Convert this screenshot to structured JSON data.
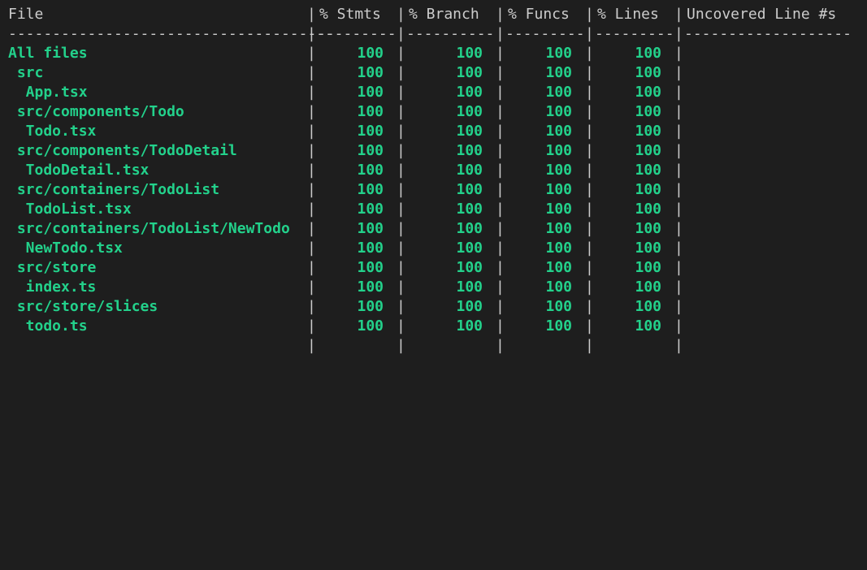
{
  "header": {
    "file": "File",
    "stmts": "% Stmts",
    "branch": "% Branch",
    "funcs": "% Funcs",
    "lines": "% Lines",
    "uncovered": "Uncovered Line #s"
  },
  "separator": {
    "file": "-------------------------------------",
    "stmts": "---------",
    "branch": "----------",
    "funcs": "---------",
    "lines": "---------",
    "uncovered": "-------------------"
  },
  "pipe": "|",
  "rows": [
    {
      "file": "All files",
      "stmts": "100",
      "branch": "100",
      "funcs": "100",
      "lines": "100",
      "uncovered": ""
    },
    {
      "file": " src",
      "stmts": "100",
      "branch": "100",
      "funcs": "100",
      "lines": "100",
      "uncovered": ""
    },
    {
      "file": "  App.tsx",
      "stmts": "100",
      "branch": "100",
      "funcs": "100",
      "lines": "100",
      "uncovered": ""
    },
    {
      "file": " src/components/Todo",
      "stmts": "100",
      "branch": "100",
      "funcs": "100",
      "lines": "100",
      "uncovered": ""
    },
    {
      "file": "  Todo.tsx",
      "stmts": "100",
      "branch": "100",
      "funcs": "100",
      "lines": "100",
      "uncovered": ""
    },
    {
      "file": " src/components/TodoDetail",
      "stmts": "100",
      "branch": "100",
      "funcs": "100",
      "lines": "100",
      "uncovered": ""
    },
    {
      "file": "  TodoDetail.tsx",
      "stmts": "100",
      "branch": "100",
      "funcs": "100",
      "lines": "100",
      "uncovered": ""
    },
    {
      "file": " src/containers/TodoList",
      "stmts": "100",
      "branch": "100",
      "funcs": "100",
      "lines": "100",
      "uncovered": ""
    },
    {
      "file": "  TodoList.tsx",
      "stmts": "100",
      "branch": "100",
      "funcs": "100",
      "lines": "100",
      "uncovered": ""
    },
    {
      "file": " src/containers/TodoList/NewTodo",
      "stmts": "100",
      "branch": "100",
      "funcs": "100",
      "lines": "100",
      "uncovered": ""
    },
    {
      "file": "  NewTodo.tsx",
      "stmts": "100",
      "branch": "100",
      "funcs": "100",
      "lines": "100",
      "uncovered": ""
    },
    {
      "file": " src/store",
      "stmts": "100",
      "branch": "100",
      "funcs": "100",
      "lines": "100",
      "uncovered": ""
    },
    {
      "file": "  index.ts",
      "stmts": "100",
      "branch": "100",
      "funcs": "100",
      "lines": "100",
      "uncovered": ""
    },
    {
      "file": " src/store/slices",
      "stmts": "100",
      "branch": "100",
      "funcs": "100",
      "lines": "100",
      "uncovered": ""
    },
    {
      "file": "  todo.ts",
      "stmts": "100",
      "branch": "100",
      "funcs": "100",
      "lines": "100",
      "uncovered": ""
    }
  ],
  "colors": {
    "background": "#1e1e1e",
    "text": "#cccccc",
    "covered": "#23d18b"
  }
}
